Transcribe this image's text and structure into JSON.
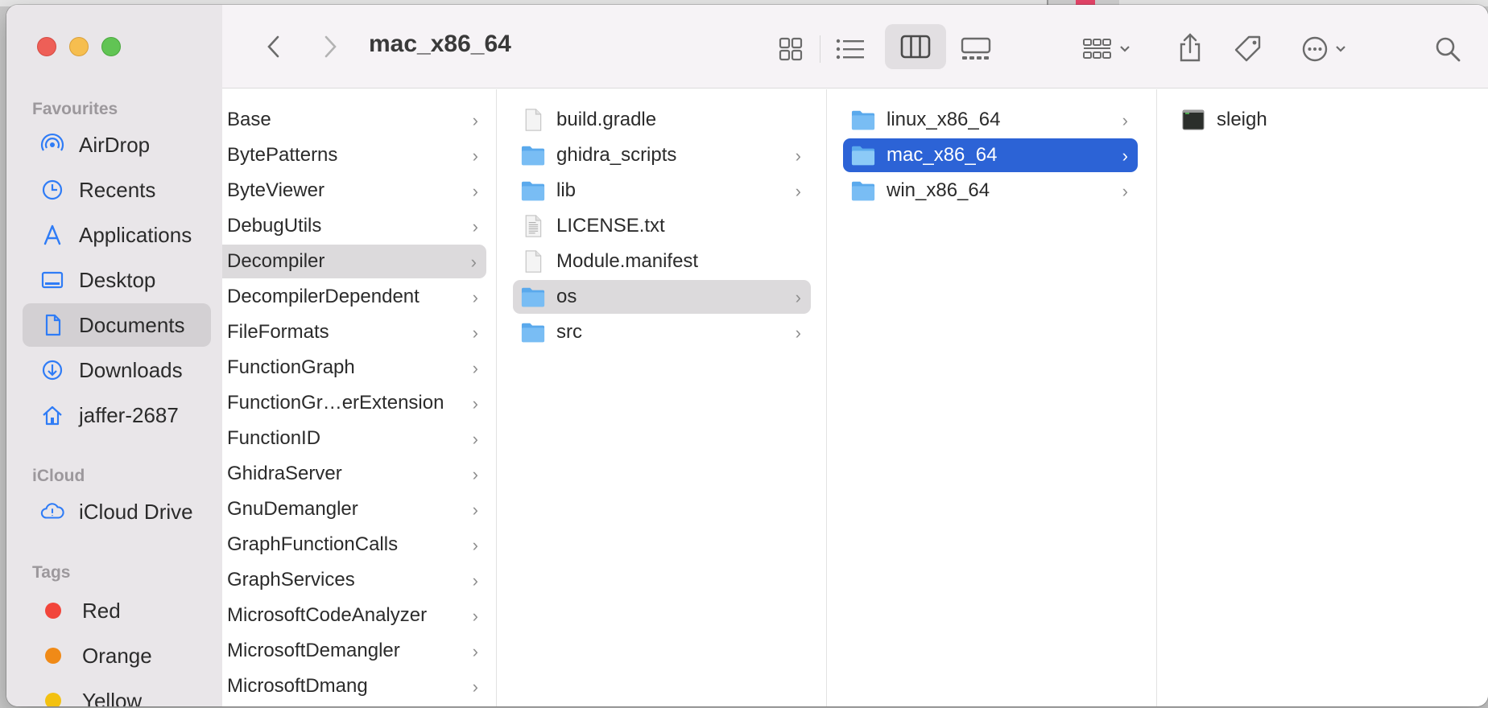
{
  "window": {
    "title": "mac_x86_64"
  },
  "sidebar": {
    "favourites_label": "Favourites",
    "favourites": [
      {
        "label": "AirDrop",
        "icon": "airdrop-icon"
      },
      {
        "label": "Recents",
        "icon": "clock-icon"
      },
      {
        "label": "Applications",
        "icon": "applications-icon"
      },
      {
        "label": "Desktop",
        "icon": "desktop-icon"
      },
      {
        "label": "Documents",
        "icon": "document-icon",
        "selected": true
      },
      {
        "label": "Downloads",
        "icon": "download-icon"
      },
      {
        "label": "jaffer-2687",
        "icon": "home-icon"
      }
    ],
    "icloud_label": "iCloud",
    "icloud": [
      {
        "label": "iCloud Drive",
        "icon": "icloud-icon"
      }
    ],
    "tags_label": "Tags",
    "tags": [
      {
        "label": "Red",
        "color": "#f2453b"
      },
      {
        "label": "Orange",
        "color": "#f08a17"
      },
      {
        "label": "Yellow",
        "color": "#f3c111"
      }
    ]
  },
  "toolbar": {
    "back_icon": "chevron-left-icon",
    "forward_icon": "chevron-right-icon",
    "views": [
      "icon-view-icon",
      "list-view-icon",
      "column-view-icon",
      "gallery-view-icon"
    ],
    "active_view": "column-view-icon"
  },
  "columns": [
    {
      "items": [
        {
          "name": "Base",
          "folder": true
        },
        {
          "name": "BytePatterns",
          "folder": true
        },
        {
          "name": "ByteViewer",
          "folder": true
        },
        {
          "name": "DebugUtils",
          "folder": true
        },
        {
          "name": "Decompiler",
          "folder": true,
          "state": "highlighted"
        },
        {
          "name": "DecompilerDependent",
          "folder": true
        },
        {
          "name": "FileFormats",
          "folder": true
        },
        {
          "name": "FunctionGraph",
          "folder": true
        },
        {
          "name": "FunctionGr…erExtension",
          "folder": true
        },
        {
          "name": "FunctionID",
          "folder": true
        },
        {
          "name": "GhidraServer",
          "folder": true
        },
        {
          "name": "GnuDemangler",
          "folder": true
        },
        {
          "name": "GraphFunctionCalls",
          "folder": true
        },
        {
          "name": "GraphServices",
          "folder": true
        },
        {
          "name": "MicrosoftCodeAnalyzer",
          "folder": true
        },
        {
          "name": "MicrosoftDemangler",
          "folder": true
        },
        {
          "name": "MicrosoftDmang",
          "folder": true
        }
      ]
    },
    {
      "items": [
        {
          "name": "build.gradle",
          "type": "file"
        },
        {
          "name": "ghidra_scripts",
          "type": "folder"
        },
        {
          "name": "lib",
          "type": "folder"
        },
        {
          "name": "LICENSE.txt",
          "type": "text"
        },
        {
          "name": "Module.manifest",
          "type": "file"
        },
        {
          "name": "os",
          "type": "folder",
          "state": "highlighted"
        },
        {
          "name": "src",
          "type": "folder"
        }
      ]
    },
    {
      "items": [
        {
          "name": "linux_x86_64",
          "type": "folder"
        },
        {
          "name": "mac_x86_64",
          "type": "folder",
          "state": "selected"
        },
        {
          "name": "win_x86_64",
          "type": "folder"
        }
      ]
    },
    {
      "items": [
        {
          "name": "sleigh",
          "type": "executable"
        }
      ]
    }
  ],
  "colors": {
    "selection": "#2c63d6",
    "folder": "#5aa9ec",
    "accent": "#2f7cf6"
  }
}
